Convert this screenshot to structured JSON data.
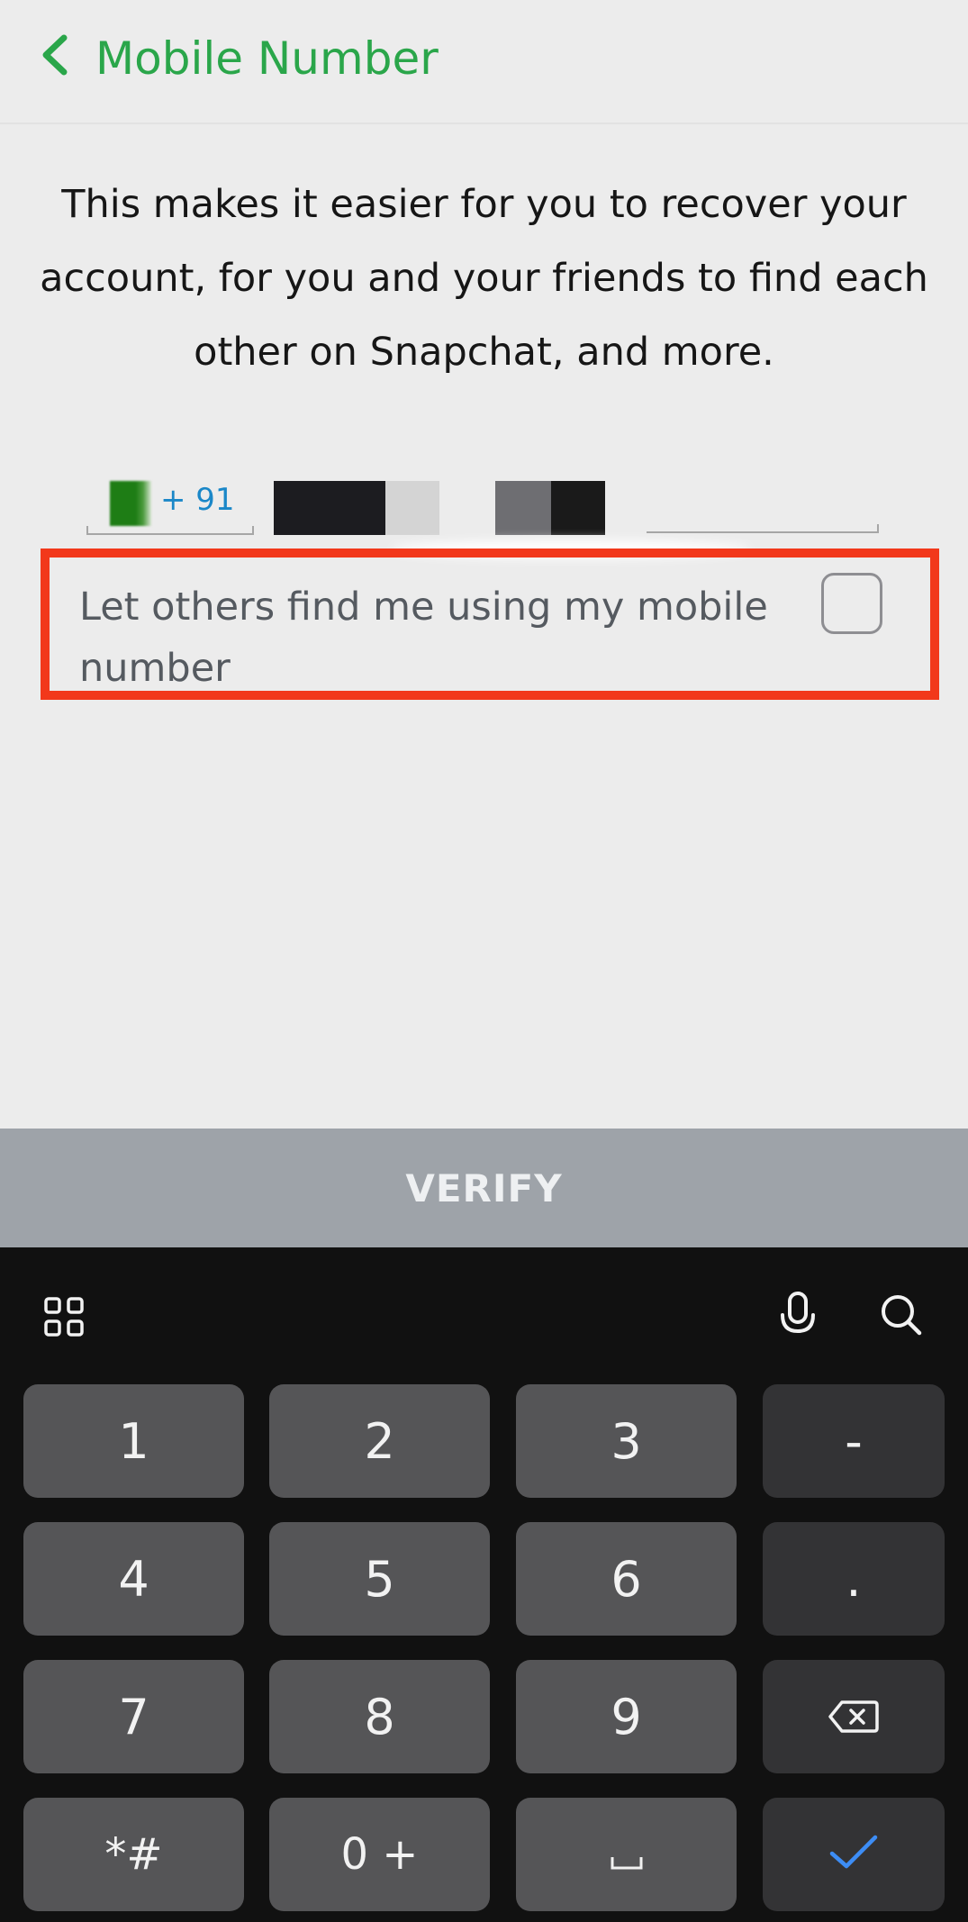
{
  "header": {
    "title": "Mobile Number",
    "accent_color": "#2aa64a"
  },
  "description": "This makes it easier for you to recover your account, for you and your friends to find each other on Snapchat, and more.",
  "phone": {
    "country_code": "+ 91"
  },
  "find_me": {
    "label": "Let others find me using my mobile number",
    "checked": false,
    "highlight_color": "#f2381b"
  },
  "verify": {
    "label": "VERIFY"
  },
  "keyboard": {
    "keys": [
      [
        "1",
        "2",
        "3",
        "-"
      ],
      [
        "4",
        "5",
        "6",
        "."
      ],
      [
        "7",
        "8",
        "9",
        "backspace-icon"
      ],
      [
        "*#",
        "0 +",
        "space-icon",
        "enter-check-icon"
      ]
    ],
    "toolbar_icons": [
      "apps-grid-icon",
      "microphone-icon",
      "search-icon"
    ]
  }
}
